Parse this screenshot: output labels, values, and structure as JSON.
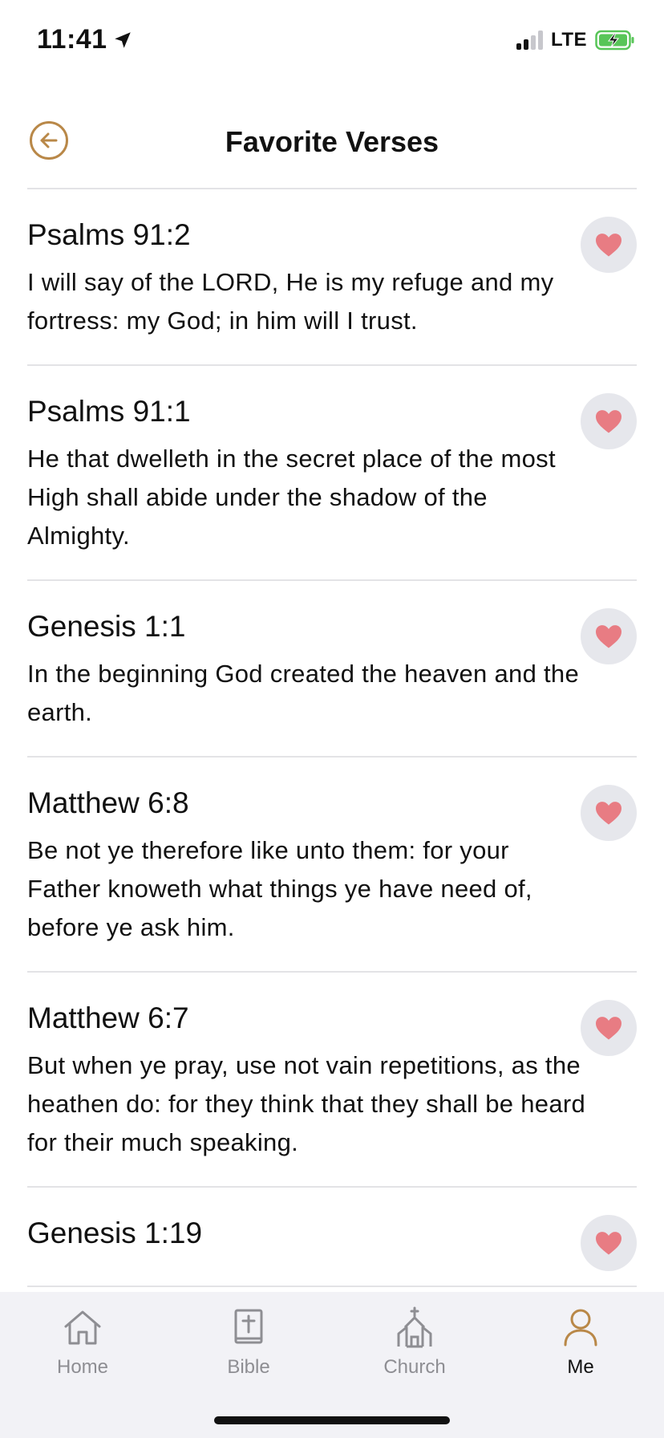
{
  "status_bar": {
    "time": "11:41",
    "network": "LTE"
  },
  "header": {
    "title": "Favorite Verses"
  },
  "colors": {
    "accent": "#b98848",
    "heart": "#e87c83",
    "heart_bg": "#e6e7ec",
    "battery": "#58c558"
  },
  "verses": [
    {
      "reference": "Psalms 91:2",
      "text": "I will say of the LORD, He is my refuge and my fortress: my God; in him will I trust."
    },
    {
      "reference": "Psalms 91:1",
      "text": "He that dwelleth in the secret place of the most High shall abide under the shadow of the Almighty."
    },
    {
      "reference": "Genesis 1:1",
      "text": "In the beginning God created the heaven and the earth."
    },
    {
      "reference": "Matthew 6:8",
      "text": "Be not ye therefore like unto them: for your Father knoweth what things ye have need of, before ye ask him."
    },
    {
      "reference": "Matthew 6:7",
      "text": "But when ye pray, use not vain repetitions, as the heathen do: for they think that they shall be heard for their much speaking."
    },
    {
      "reference": "Genesis 1:19",
      "text": ""
    }
  ],
  "tabs": [
    {
      "label": "Home",
      "icon": "home-icon",
      "active": false
    },
    {
      "label": "Bible",
      "icon": "bible-icon",
      "active": false
    },
    {
      "label": "Church",
      "icon": "church-icon",
      "active": false
    },
    {
      "label": "Me",
      "icon": "person-icon",
      "active": true
    }
  ]
}
